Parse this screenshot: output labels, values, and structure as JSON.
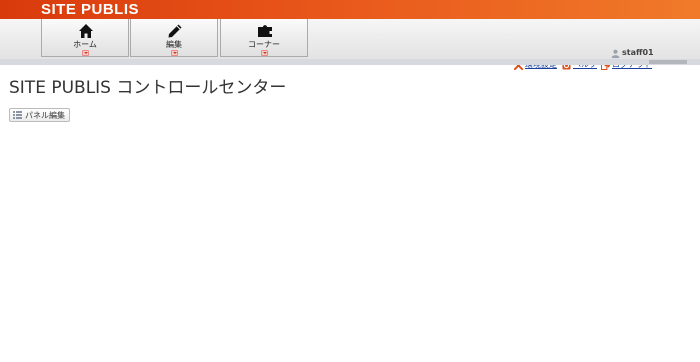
{
  "brand": {
    "title": "SITE PUBLIS"
  },
  "menu": [
    {
      "label": "ホーム",
      "icon": "home-icon"
    },
    {
      "label": "編集",
      "icon": "pencil-icon"
    },
    {
      "label": "コーナー",
      "icon": "puzzle-icon"
    }
  ],
  "user": {
    "name": "staff01",
    "icon": "user-icon"
  },
  "utility": {
    "settings": "環境設定",
    "help": "ヘルプ",
    "logout": "ログアウト"
  },
  "main": {
    "title": "SITE PUBLIS コントロールセンター",
    "panel_edit_label": "パネル編集"
  },
  "colors": {
    "header_start": "#d93a0c",
    "header_end": "#f07a2a",
    "link": "#1a3f9c",
    "accent_orange": "#e0501c"
  }
}
